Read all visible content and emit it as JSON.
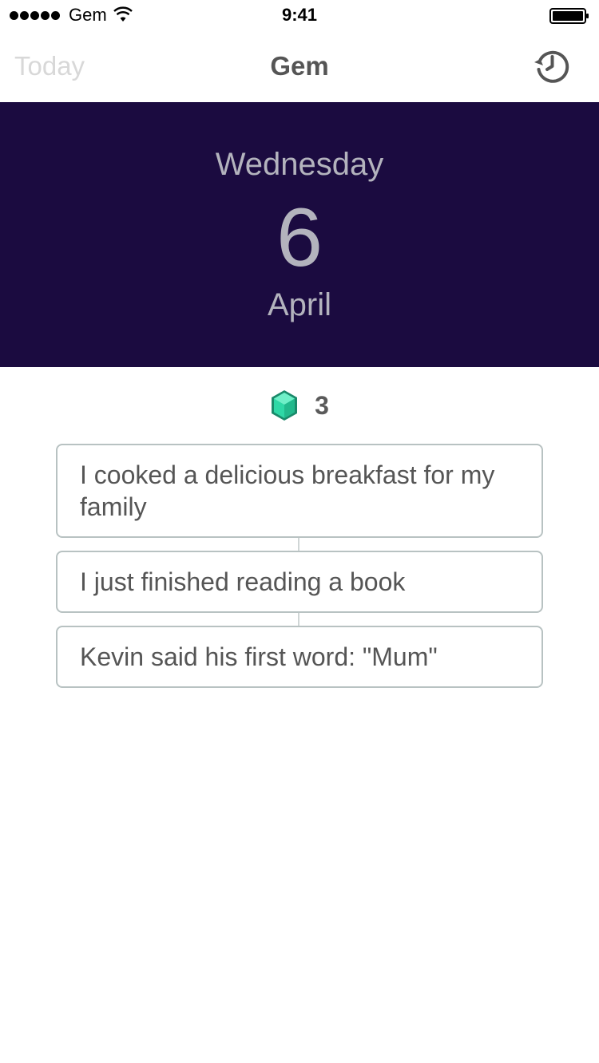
{
  "status_bar": {
    "carrier": "Gem",
    "time": "9:41"
  },
  "nav": {
    "left_label": "Today",
    "title": "Gem",
    "right_icon": "history-icon"
  },
  "date": {
    "weekday": "Wednesday",
    "day": "6",
    "month": "April",
    "background": "#1b0b40"
  },
  "gems": {
    "count": "3",
    "icon": "gem-icon",
    "color": "#2ed8a6"
  },
  "entries": [
    {
      "text": "I cooked a delicious breakfast for my family"
    },
    {
      "text": "I just finished reading a book"
    },
    {
      "text": "Kevin said his first word: \"Mum\""
    }
  ]
}
